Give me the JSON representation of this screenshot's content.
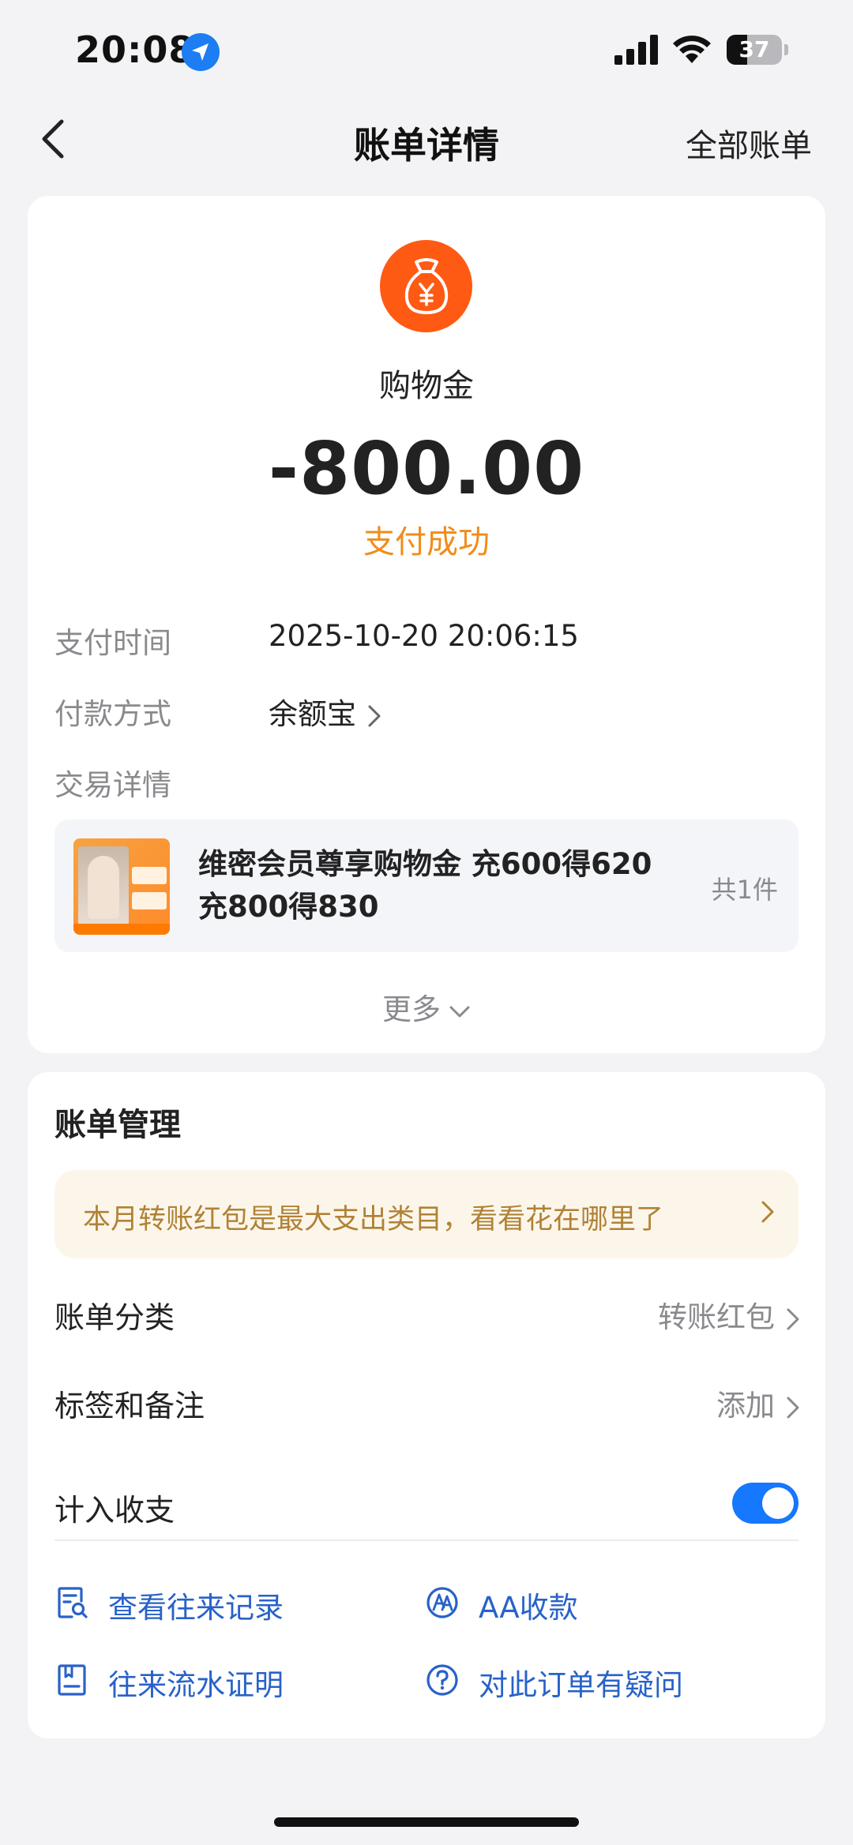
{
  "status_bar": {
    "time": "20:08",
    "battery": "37",
    "battery_level": 0.37
  },
  "nav": {
    "title": "账单详情",
    "right_action": "全部账单"
  },
  "bill": {
    "merchant": "购物金",
    "amount": "-800.00",
    "status": "支付成功",
    "rows": [
      {
        "label": "支付时间",
        "value": "2025-10-20 20:06:15"
      },
      {
        "label": "付款方式",
        "value": "余额宝"
      },
      {
        "label": "交易详情"
      }
    ],
    "trade": {
      "title_line1": "维密会员尊享购物金 充600得620",
      "title_line2": "充800得830",
      "count": "共1件"
    },
    "more": "更多"
  },
  "manage": {
    "title": "账单管理",
    "tip": "本月转账红包是最大支出类目，看看花在哪里了",
    "category_label": "账单分类",
    "category_value": "转账红包",
    "tags_label": "标签和备注",
    "tags_value": "添加",
    "include_label": "计入收支",
    "include_on": true,
    "actions": [
      "查看往来记录",
      "AA收款",
      "往来流水证明",
      "对此订单有疑问"
    ]
  },
  "colors": {
    "accent_blue": "#1677ff",
    "success_orange": "#f08c1b",
    "merchant_orange": "#ff5a14",
    "link_blue": "#2862c9"
  }
}
